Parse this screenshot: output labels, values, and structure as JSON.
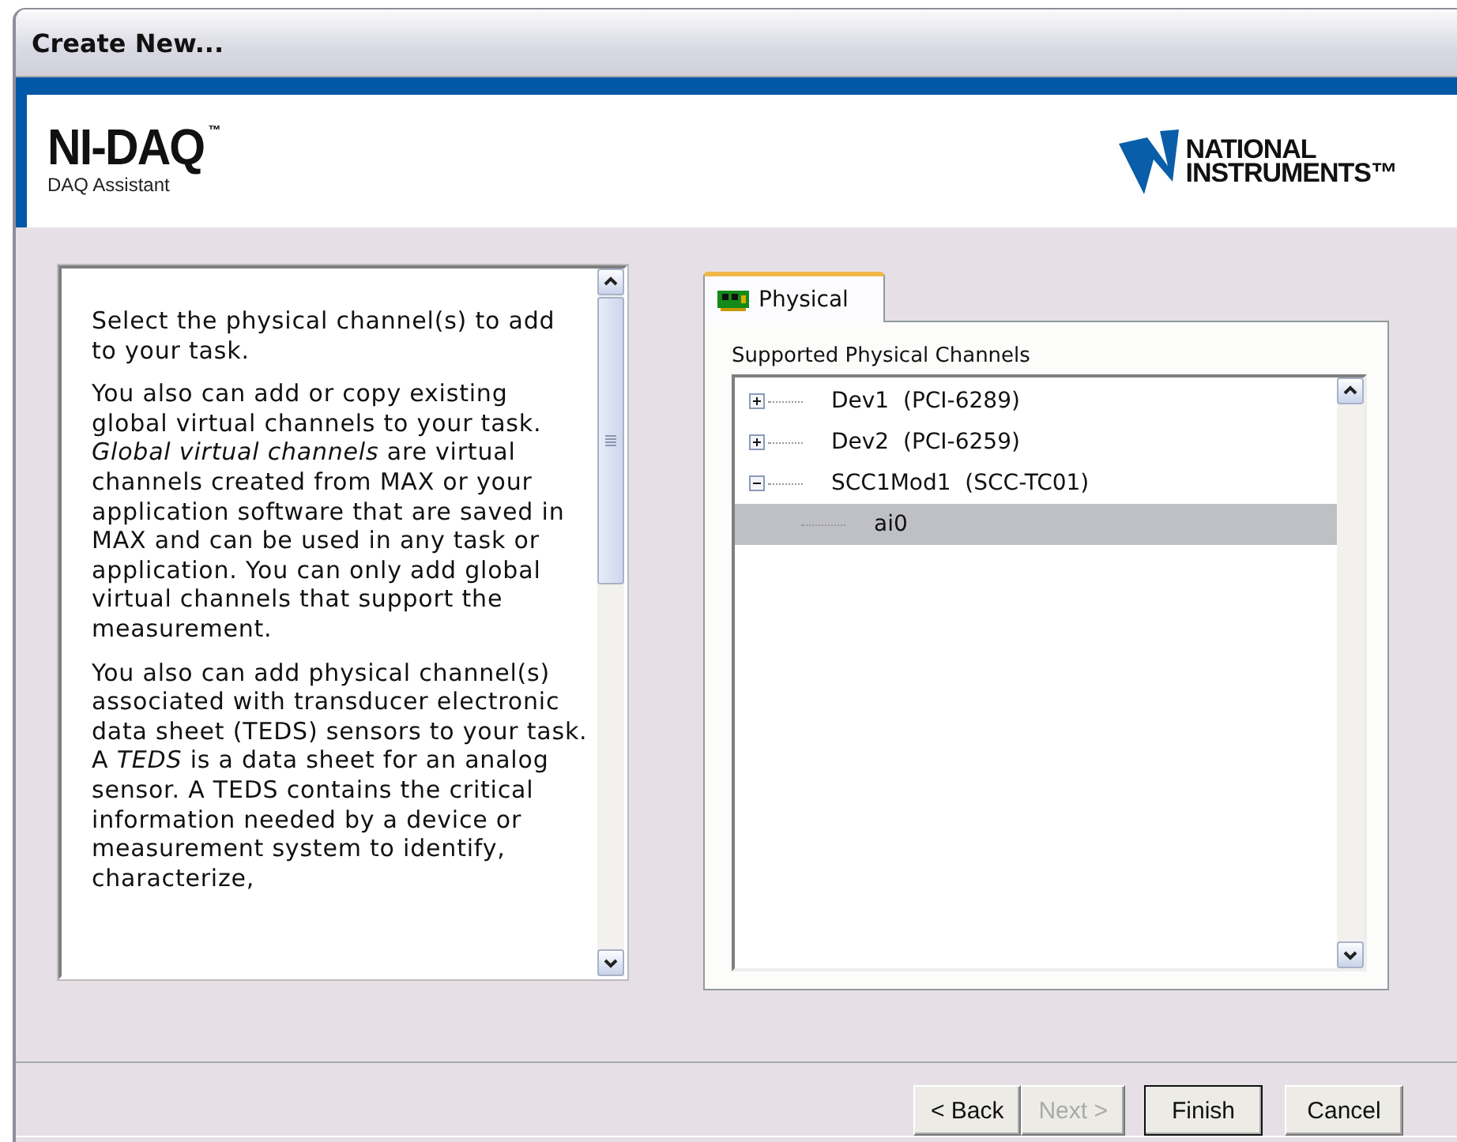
{
  "window": {
    "title": "Create New..."
  },
  "header": {
    "product": "NI-DAQ",
    "trademark": "™",
    "subtitle": "DAQ Assistant",
    "logo_lines": [
      "NATIONAL",
      "INSTRUMENTS™"
    ]
  },
  "help_text": [
    "Select the physical channel(s) to add to your task.",
    "You also can add or copy existing global virtual channels to your task. *Global virtual channels* are virtual channels created from MAX or your application software that are saved in MAX and can be used in any task or application. You can only add global virtual channels that support the measurement.",
    "You also can add physical channel(s) associated with transducer electronic data sheet (TEDS) sensors to your task. A *TEDS* is a data sheet for an analog sensor. A TEDS contains the critical information needed by a device or measurement system to identify, characterize,"
  ],
  "tabs": [
    {
      "label": "Physical",
      "selected": true
    }
  ],
  "tree": {
    "label": "Supported Physical Channels",
    "items": [
      {
        "label": "Dev1  (PCI-6289)",
        "expanded": false,
        "selected": false
      },
      {
        "label": "Dev2  (PCI-6259)",
        "expanded": false,
        "selected": false
      },
      {
        "label": "SCC1Mod1  (SCC-TC01)",
        "expanded": true,
        "selected": false,
        "children": [
          {
            "label": "ai0",
            "selected": true
          }
        ]
      }
    ]
  },
  "buttons": [
    {
      "label": "< Back",
      "disabled": false,
      "default": false
    },
    {
      "label": "Next >",
      "disabled": true,
      "default": false
    },
    {
      "label": "Finish",
      "disabled": false,
      "default": true
    },
    {
      "label": "Cancel",
      "disabled": false,
      "default": false
    }
  ]
}
